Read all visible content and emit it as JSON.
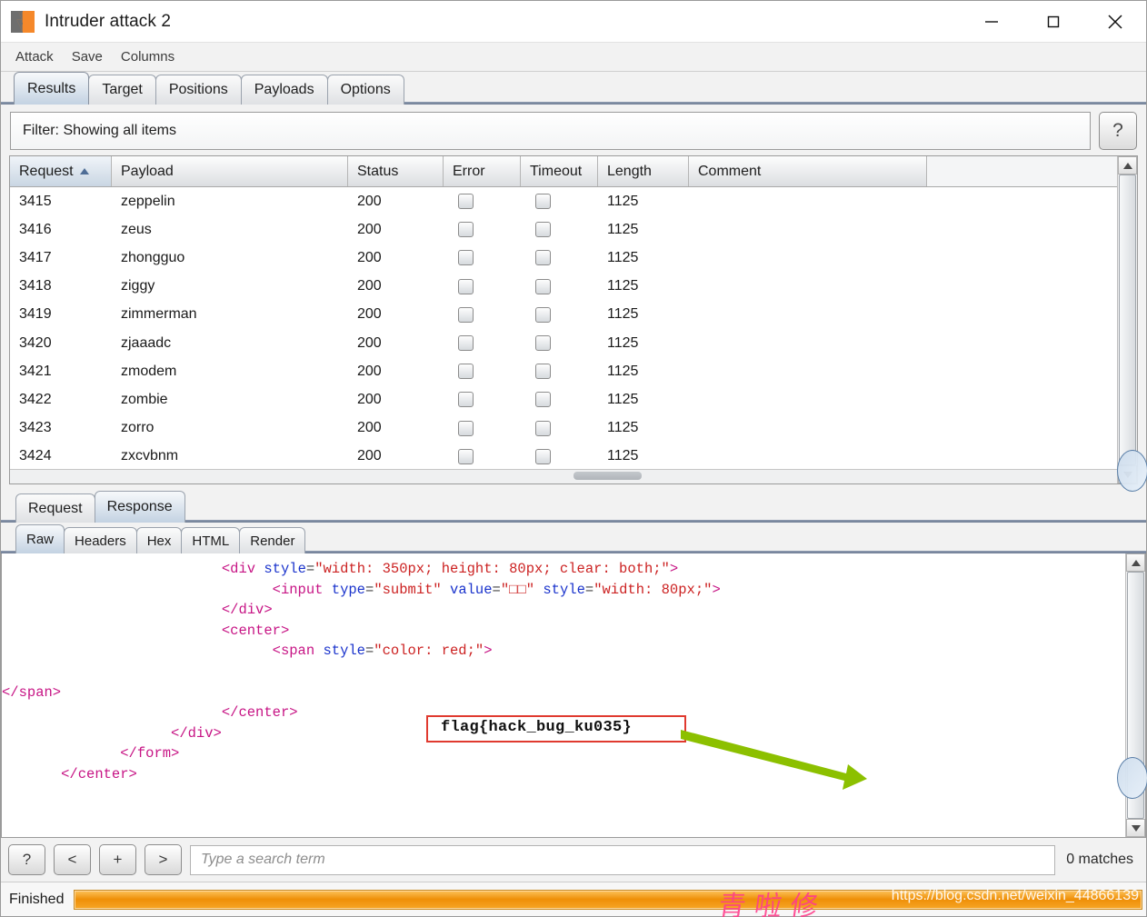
{
  "window": {
    "title": "Intruder attack 2",
    "icon": "burp-suite-icon",
    "controls": {
      "minimize": "minimize-icon",
      "maximize": "maximize-icon",
      "close": "close-icon"
    }
  },
  "menubar": {
    "items": [
      "Attack",
      "Save",
      "Columns"
    ]
  },
  "main_tabs": {
    "items": [
      "Results",
      "Target",
      "Positions",
      "Payloads",
      "Options"
    ],
    "active": "Results"
  },
  "filter": {
    "label": "Filter:",
    "text": "Filter: Showing all items",
    "help_label": "?"
  },
  "results_table": {
    "columns": [
      "Request",
      "Payload",
      "Status",
      "Error",
      "Timeout",
      "Length",
      "Comment"
    ],
    "sorted_column": "Request",
    "sort_direction": "ascending",
    "rows": [
      {
        "request": "3415",
        "payload": "zeppelin",
        "status": "200",
        "error": false,
        "timeout": false,
        "length": "1125",
        "comment": ""
      },
      {
        "request": "3416",
        "payload": "zeus",
        "status": "200",
        "error": false,
        "timeout": false,
        "length": "1125",
        "comment": ""
      },
      {
        "request": "3417",
        "payload": "zhongguo",
        "status": "200",
        "error": false,
        "timeout": false,
        "length": "1125",
        "comment": ""
      },
      {
        "request": "3418",
        "payload": "ziggy",
        "status": "200",
        "error": false,
        "timeout": false,
        "length": "1125",
        "comment": ""
      },
      {
        "request": "3419",
        "payload": "zimmerman",
        "status": "200",
        "error": false,
        "timeout": false,
        "length": "1125",
        "comment": ""
      },
      {
        "request": "3420",
        "payload": "zjaaadc",
        "status": "200",
        "error": false,
        "timeout": false,
        "length": "1125",
        "comment": ""
      },
      {
        "request": "3421",
        "payload": "zmodem",
        "status": "200",
        "error": false,
        "timeout": false,
        "length": "1125",
        "comment": ""
      },
      {
        "request": "3422",
        "payload": "zombie",
        "status": "200",
        "error": false,
        "timeout": false,
        "length": "1125",
        "comment": ""
      },
      {
        "request": "3423",
        "payload": "zorro",
        "status": "200",
        "error": false,
        "timeout": false,
        "length": "1125",
        "comment": ""
      },
      {
        "request": "3424",
        "payload": "zxcvbnm",
        "status": "200",
        "error": false,
        "timeout": false,
        "length": "1125",
        "comment": ""
      }
    ]
  },
  "message_tabs": {
    "items": [
      "Request",
      "Response"
    ],
    "active": "Response"
  },
  "view_tabs": {
    "items": [
      "Raw",
      "Headers",
      "Hex",
      "HTML",
      "Render"
    ],
    "active": "Raw"
  },
  "response_code": {
    "lines": [
      {
        "indent": 26,
        "parts": [
          {
            "t": "<div ",
            "c": "k-tag"
          },
          {
            "t": "style",
            "c": "k-attr"
          },
          {
            "t": "=",
            "c": "k-brk"
          },
          {
            "t": "\"width: 350px; height: 80px; clear: both;\"",
            "c": "k-val"
          },
          {
            "t": ">",
            "c": "k-tag"
          }
        ]
      },
      {
        "indent": 32,
        "parts": [
          {
            "t": "<input ",
            "c": "k-tag"
          },
          {
            "t": "type",
            "c": "k-attr"
          },
          {
            "t": "=",
            "c": "k-brk"
          },
          {
            "t": "\"submit\" ",
            "c": "k-val"
          },
          {
            "t": "value",
            "c": "k-attr"
          },
          {
            "t": "=",
            "c": "k-brk"
          },
          {
            "t": "\"□□\" ",
            "c": "k-val"
          },
          {
            "t": "style",
            "c": "k-attr"
          },
          {
            "t": "=",
            "c": "k-brk"
          },
          {
            "t": "\"width: 80px;\"",
            "c": "k-val"
          },
          {
            "t": ">",
            "c": "k-tag"
          }
        ]
      },
      {
        "indent": 26,
        "parts": [
          {
            "t": "</div>",
            "c": "k-tag"
          }
        ]
      },
      {
        "indent": 26,
        "parts": [
          {
            "t": "<center>",
            "c": "k-tag"
          }
        ]
      },
      {
        "indent": 32,
        "parts": [
          {
            "t": "<span ",
            "c": "k-tag"
          },
          {
            "t": "style",
            "c": "k-attr"
          },
          {
            "t": "=",
            "c": "k-brk"
          },
          {
            "t": "\"color: red;\"",
            "c": "k-val"
          },
          {
            "t": ">",
            "c": "k-tag"
          }
        ]
      },
      {
        "indent": 0,
        "parts": []
      },
      {
        "indent": 0,
        "parts": [
          {
            "t": "</span>",
            "c": "k-tag"
          }
        ]
      },
      {
        "indent": 26,
        "parts": [
          {
            "t": "</center>",
            "c": "k-tag"
          }
        ]
      },
      {
        "indent": 20,
        "parts": [
          {
            "t": "</div>",
            "c": "k-tag"
          }
        ]
      },
      {
        "indent": 14,
        "parts": [
          {
            "t": "</form>",
            "c": "k-tag"
          }
        ]
      },
      {
        "indent": 7,
        "parts": [
          {
            "t": "</center>",
            "c": "k-tag"
          }
        ]
      }
    ]
  },
  "annotation": {
    "flag": "flag{hack_bug_ku035}",
    "box_color": "#e03a2f",
    "arrow_color": "#8cc000"
  },
  "search_bar": {
    "buttons": [
      "?",
      "<",
      "+",
      ">"
    ],
    "placeholder": "Type a search term",
    "value": "",
    "matches": "0 matches"
  },
  "status_bar": {
    "label": "Finished",
    "progress_percent": 100,
    "progress_color": "#ef8f07"
  },
  "watermark": {
    "url": "https://blog.csdn.net/weixin_44866139",
    "signature": "青 啦 修"
  }
}
